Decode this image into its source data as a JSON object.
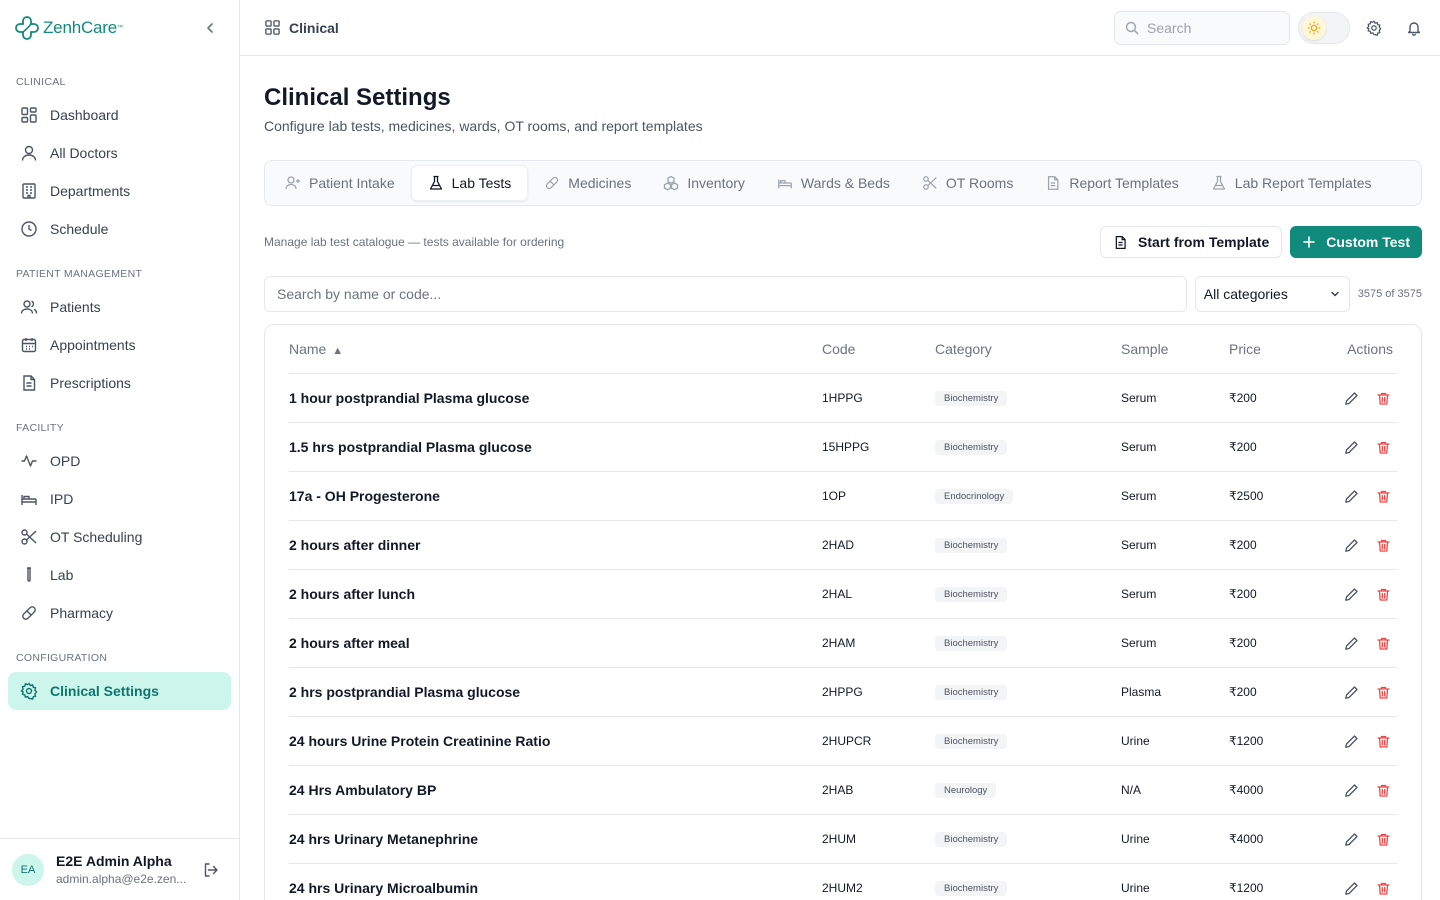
{
  "brand": {
    "name": "ZenhCare",
    "tm": "™",
    "color": "#0f8a7b"
  },
  "sidebar": {
    "sections": [
      {
        "heading": "CLINICAL",
        "items": [
          {
            "label": "Dashboard",
            "icon": "grid-icon"
          },
          {
            "label": "All Doctors",
            "icon": "user-icon"
          },
          {
            "label": "Departments",
            "icon": "building-icon"
          },
          {
            "label": "Schedule",
            "icon": "clock-icon"
          }
        ]
      },
      {
        "heading": "PATIENT MANAGEMENT",
        "items": [
          {
            "label": "Patients",
            "icon": "users-icon"
          },
          {
            "label": "Appointments",
            "icon": "calendar-icon"
          },
          {
            "label": "Prescriptions",
            "icon": "file-icon"
          }
        ]
      },
      {
        "heading": "FACILITY",
        "items": [
          {
            "label": "OPD",
            "icon": "activity-icon"
          },
          {
            "label": "IPD",
            "icon": "bed-icon"
          },
          {
            "label": "OT Scheduling",
            "icon": "scissors-icon"
          },
          {
            "label": "Lab",
            "icon": "test-tube-icon"
          },
          {
            "label": "Pharmacy",
            "icon": "pill-icon"
          }
        ]
      },
      {
        "heading": "CONFIGURATION",
        "items": [
          {
            "label": "Clinical Settings",
            "icon": "gear-icon",
            "active": true
          }
        ]
      }
    ],
    "user": {
      "initials": "EA",
      "name": "E2E Admin Alpha",
      "email": "admin.alpha@e2e.zen..."
    }
  },
  "topbar": {
    "breadcrumb": "Clinical",
    "search_placeholder": "Search"
  },
  "page": {
    "title": "Clinical Settings",
    "subtitle": "Configure lab tests, medicines, wards, OT rooms, and report templates"
  },
  "tabs": [
    {
      "label": "Patient Intake",
      "icon": "user-plus-icon"
    },
    {
      "label": "Lab Tests",
      "icon": "flask-icon",
      "active": true
    },
    {
      "label": "Medicines",
      "icon": "pill-icon"
    },
    {
      "label": "Inventory",
      "icon": "boxes-icon"
    },
    {
      "label": "Wards & Beds",
      "icon": "bed-icon"
    },
    {
      "label": "OT Rooms",
      "icon": "scissors-icon"
    },
    {
      "label": "Report Templates",
      "icon": "file-text-icon"
    },
    {
      "label": "Lab Report Templates",
      "icon": "flask-icon"
    }
  ],
  "toolbar": {
    "description": "Manage lab test catalogue — tests available for ordering",
    "template_button": "Start from Template",
    "custom_button": "Custom Test"
  },
  "filters": {
    "search_placeholder": "Search by name or code...",
    "category_selected": "All categories",
    "count": "3575 of 3575"
  },
  "table": {
    "headers": {
      "name": "Name",
      "code": "Code",
      "category": "Category",
      "sample": "Sample",
      "price": "Price",
      "actions": "Actions"
    },
    "sort_indicator": "▲",
    "rows": [
      {
        "name": "1 hour postprandial Plasma glucose",
        "code": "1HPPG",
        "category": "Biochemistry",
        "sample": "Serum",
        "price": "₹200"
      },
      {
        "name": "1.5 hrs postprandial Plasma glucose",
        "code": "15HPPG",
        "category": "Biochemistry",
        "sample": "Serum",
        "price": "₹200"
      },
      {
        "name": "17a - OH Progesterone",
        "code": "1OP",
        "category": "Endocrinology",
        "sample": "Serum",
        "price": "₹2500"
      },
      {
        "name": "2 hours after dinner",
        "code": "2HAD",
        "category": "Biochemistry",
        "sample": "Serum",
        "price": "₹200"
      },
      {
        "name": "2 hours after lunch",
        "code": "2HAL",
        "category": "Biochemistry",
        "sample": "Serum",
        "price": "₹200"
      },
      {
        "name": "2 hours after meal",
        "code": "2HAM",
        "category": "Biochemistry",
        "sample": "Serum",
        "price": "₹200"
      },
      {
        "name": "2 hrs postprandial Plasma glucose",
        "code": "2HPPG",
        "category": "Biochemistry",
        "sample": "Plasma",
        "price": "₹200"
      },
      {
        "name": "24 hours Urine Protein Creatinine Ratio",
        "code": "2HUPCR",
        "category": "Biochemistry",
        "sample": "Urine",
        "price": "₹1200"
      },
      {
        "name": "24 Hrs Ambulatory BP",
        "code": "2HAB",
        "category": "Neurology",
        "sample": "N/A",
        "price": "₹4000"
      },
      {
        "name": "24 hrs Urinary Metanephrine",
        "code": "2HUM",
        "category": "Biochemistry",
        "sample": "Urine",
        "price": "₹4000"
      },
      {
        "name": "24 hrs Urinary Microalbumin",
        "code": "2HUM2",
        "category": "Biochemistry",
        "sample": "Urine",
        "price": "₹1200"
      }
    ]
  },
  "colors": {
    "accent": "#0f8a7b",
    "active_bg": "#ccf5ec",
    "danger": "#ef4444"
  }
}
